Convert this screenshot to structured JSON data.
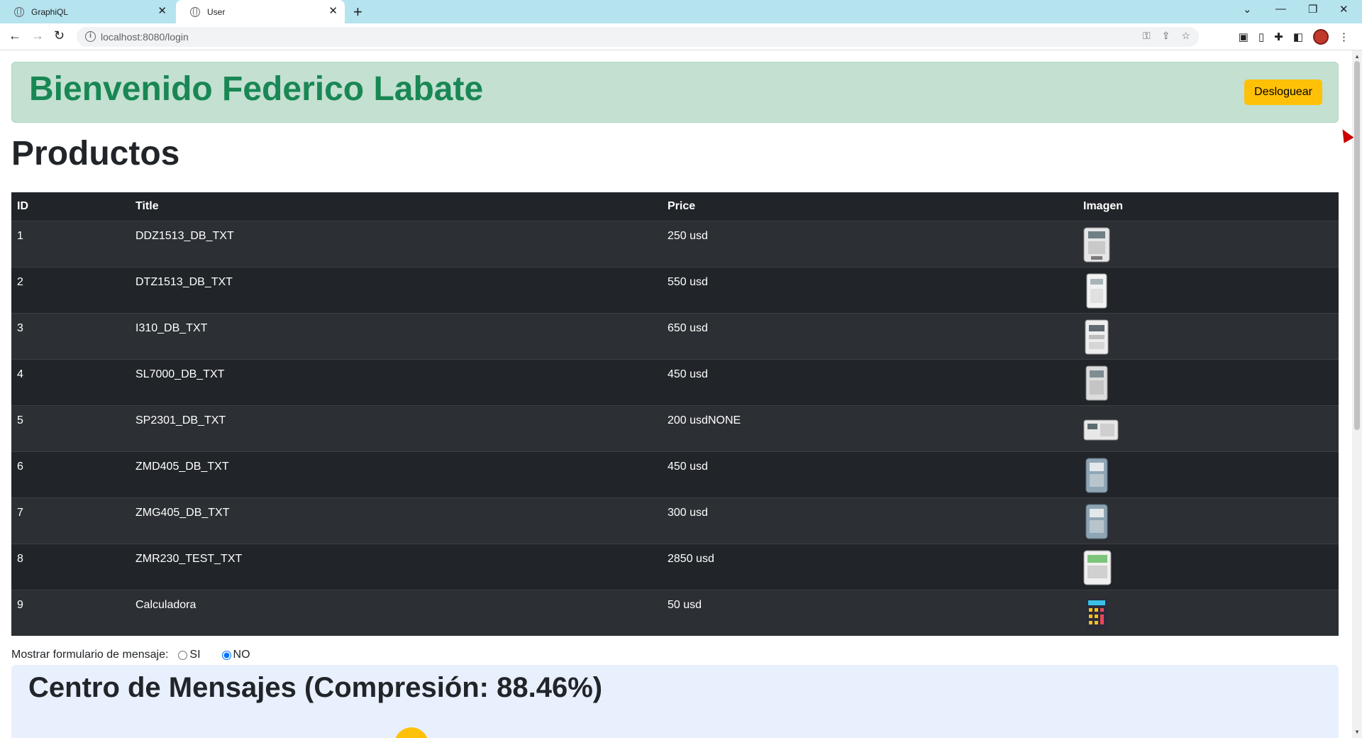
{
  "browser": {
    "tabs": [
      {
        "label": "GraphiQL",
        "active": false
      },
      {
        "label": "User",
        "active": true
      }
    ],
    "new_tab_label": "+",
    "url": "localhost:8080/login"
  },
  "header": {
    "welcome": "Bienvenido Federico Labate",
    "logout_label": "Desloguear"
  },
  "products": {
    "title": "Productos",
    "columns": [
      "ID",
      "Title",
      "Price",
      "Imagen"
    ],
    "rows": [
      {
        "id": "1",
        "title": "DDZ1513_DB_TXT",
        "price": "250 usd",
        "image": "meter-icon"
      },
      {
        "id": "2",
        "title": "DTZ1513_DB_TXT",
        "price": "550 usd",
        "image": "meter-icon"
      },
      {
        "id": "3",
        "title": "I310_DB_TXT",
        "price": "650 usd",
        "image": "meter-icon"
      },
      {
        "id": "4",
        "title": "SL7000_DB_TXT",
        "price": "450 usd",
        "image": "meter-icon"
      },
      {
        "id": "5",
        "title": "SP2301_DB_TXT",
        "price": "200 usdNONE",
        "image": "meter-icon"
      },
      {
        "id": "6",
        "title": "ZMD405_DB_TXT",
        "price": "450 usd",
        "image": "meter-icon"
      },
      {
        "id": "7",
        "title": "ZMG405_DB_TXT",
        "price": "300 usd",
        "image": "meter-icon"
      },
      {
        "id": "8",
        "title": "ZMR230_TEST_TXT",
        "price": "2850 usd",
        "image": "meter-icon"
      },
      {
        "id": "9",
        "title": "Calculadora",
        "price": "50 usd",
        "image": "calculator-icon"
      }
    ]
  },
  "message_toggle": {
    "label": "Mostrar formulario de mensaje:",
    "options": [
      "SI",
      "NO"
    ],
    "selected": "NO"
  },
  "messages": {
    "title": "Centro de Mensajes (Compresión: 88.46%)"
  },
  "colors": {
    "welcome_green": "#198754",
    "banner_bg": "#c3e0d1",
    "logout_yellow": "#ffc107",
    "table_dark": "#212529",
    "message_bg": "#e8f0fd"
  }
}
